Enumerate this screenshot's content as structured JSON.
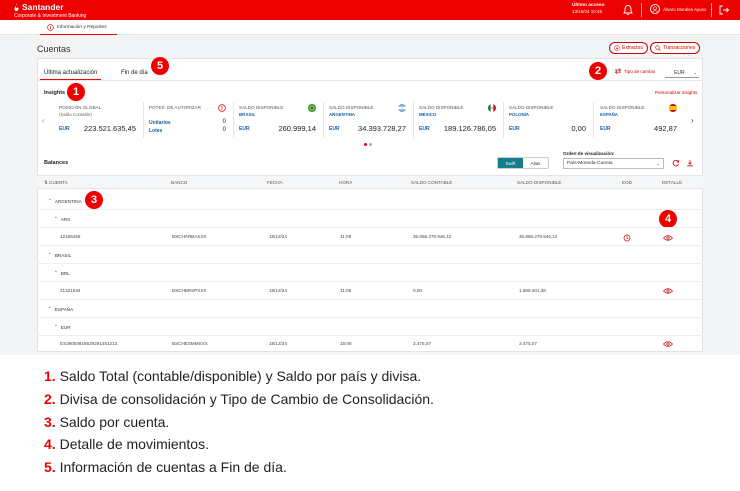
{
  "app": {
    "brand": "Santander",
    "brand_sub": "Corporate & Investment Banking",
    "last_access_label": "Último acceso",
    "last_access_value": "13/10/24 10:45",
    "user_name": "Álvaro Morales Ayuso"
  },
  "subnav": {
    "tab": "Información y Reportes"
  },
  "page": {
    "title": "Cuentas",
    "btn_extractos": "Extractos",
    "btn_transacciones": "Transacciones"
  },
  "tabs": {
    "ultima": "Última actualización",
    "fin_dia": "Fin de día"
  },
  "fx": {
    "link": "Tipo de cambio",
    "currency": "EUR"
  },
  "insights": {
    "title": "Insights",
    "personalize": "Personalizar insights",
    "cards": [
      {
        "title": "Posición global",
        "sub": "(Saldo Contable)",
        "cur": "EUR",
        "value": "223.521.635,45"
      },
      {
        "title": "Potes. de autorizar",
        "row1_label": "Unitarios",
        "row1_value": "0",
        "row2_label": "Lotes",
        "row2_value": "0"
      },
      {
        "title": "Saldo disponible",
        "sub": "Brasil",
        "cur": "EUR",
        "value": "260.999,14"
      },
      {
        "title": "Saldo disponible",
        "sub": "Argentina",
        "cur": "EUR",
        "value": "34.393.728,27"
      },
      {
        "title": "Saldo disponible",
        "sub": "México",
        "cur": "EUR",
        "value": "189.126.786,05"
      },
      {
        "title": "Saldo disponible",
        "sub": "Polonia",
        "cur": "EUR",
        "value": "0,00"
      },
      {
        "title": "Saldo disponible",
        "sub": "España",
        "cur": "EUR",
        "value": "492,87"
      }
    ]
  },
  "balances": {
    "title": "Balances",
    "toggle_swift": "Swift",
    "toggle_alias": "Alias",
    "order_label": "Orden de visualización:",
    "order_value": "País-Moneda-Cuenta",
    "headers": [
      "Cuenta",
      "Banco",
      "Fecha",
      "Hora",
      "Saldo contable",
      "Saldo disponible",
      "EOD",
      "Detalle"
    ],
    "groups": [
      {
        "country": "ARGENTINA",
        "currency": "ARS",
        "rows": [
          {
            "cuenta": "12156456",
            "banco": "BSCHARBAXXX",
            "fecha": "18/12/24",
            "hora": "11:08",
            "contable": "36.866.278.946,12",
            "disponible": "36.866.278.946,12"
          }
        ]
      },
      {
        "country": "BRASIL",
        "currency": "BRL",
        "rows": [
          {
            "cuenta": "21321534",
            "banco": "BSCHBRSPXXX",
            "fecha": "18/12/24",
            "hora": "11:08",
            "contable": "0,00",
            "disponible": "1.689.401,38"
          }
        ]
      },
      {
        "country": "ESPAÑA",
        "currency": "EUR",
        "rows": [
          {
            "cuenta": "ES39004918529291451213",
            "banco": "BSCHESMMXXX",
            "fecha": "18/12/24",
            "hora": "15:08",
            "contable": "3.475,07",
            "disponible": "3.475,07"
          }
        ]
      }
    ]
  },
  "badges": [
    "1",
    "2",
    "3",
    "4",
    "5"
  ],
  "legend": [
    {
      "num": "1.",
      "text": "Saldo Total (contable/disponible) y Saldo por país y divisa."
    },
    {
      "num": "2.",
      "text": "Divisa de consolidación y Tipo de Cambio de Consolidación."
    },
    {
      "num": "3.",
      "text": "Saldo por cuenta."
    },
    {
      "num": "4.",
      "text": "Detalle de movimientos."
    },
    {
      "num": "5.",
      "text": "Información de cuentas a Fin de día."
    }
  ],
  "colors": {
    "brand_red": "#ec0000",
    "toggle_teal": "#137e8c",
    "link_blue": "#1a5fa6"
  }
}
